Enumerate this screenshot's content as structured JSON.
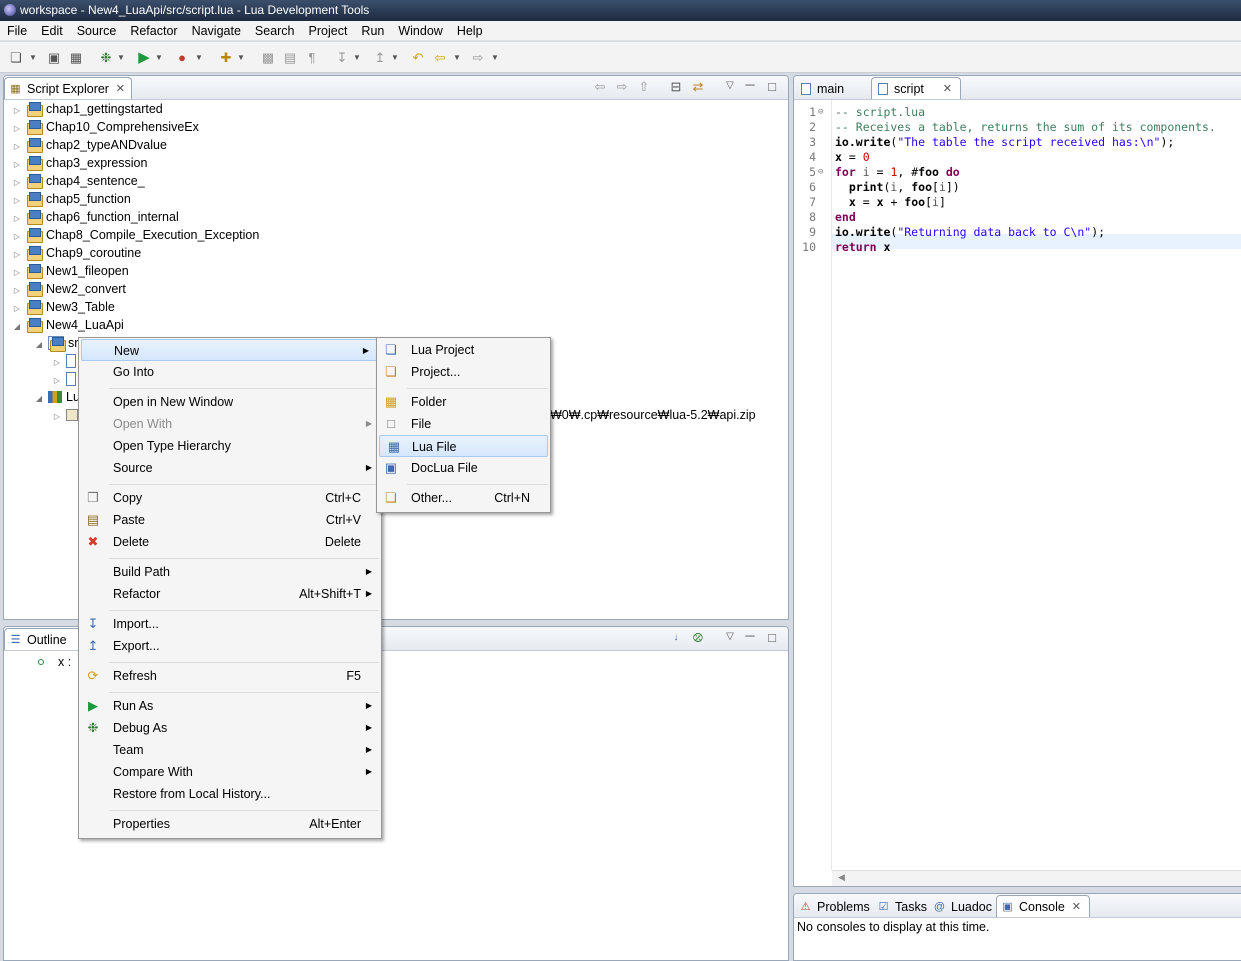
{
  "window": {
    "title": "workspace - New4_LuaApi/src/script.lua - Lua Development Tools"
  },
  "menubar": [
    "File",
    "Edit",
    "Source",
    "Refactor",
    "Navigate",
    "Search",
    "Project",
    "Run",
    "Window",
    "Help"
  ],
  "explorer": {
    "tab_label": "Script Explorer",
    "projects": [
      "chap1_gettingstarted",
      "Chap10_ComprehensiveEx",
      "chap2_typeANDvalue",
      "chap3_expression",
      "chap4_sentence_",
      "chap5_function",
      "chap6_function_internal",
      "Chap8_Compile_Execution_Exception",
      "Chap9_coroutine",
      "New1_fileopen",
      "New2_convert",
      "New3_Table",
      "New4_LuaApi"
    ],
    "src_label": "src",
    "lib_label": "Lu",
    "lib_path_fragment": "₩0₩.cp₩resource₩lua-5.2₩api.zip"
  },
  "outline": {
    "tab_label": "Outline",
    "item": "x :"
  },
  "context_menu": {
    "items": [
      {
        "label": "New",
        "shortcut": "",
        "submenu": true
      },
      {
        "label": "Go Into",
        "shortcut": "",
        "submenu": false
      },
      {
        "label": "Open in New Window",
        "shortcut": "",
        "submenu": false
      },
      {
        "label": "Open With",
        "shortcut": "",
        "submenu": true,
        "disabled": true
      },
      {
        "label": "Open Type Hierarchy",
        "shortcut": "",
        "submenu": false
      },
      {
        "label": "Source",
        "shortcut": "",
        "submenu": true
      },
      {
        "label": "Copy",
        "shortcut": "Ctrl+C",
        "submenu": false,
        "icon": "copy-icon"
      },
      {
        "label": "Paste",
        "shortcut": "Ctrl+V",
        "submenu": false,
        "icon": "paste-icon"
      },
      {
        "label": "Delete",
        "shortcut": "Delete",
        "submenu": false,
        "icon": "delete-icon"
      },
      {
        "label": "Build Path",
        "shortcut": "",
        "submenu": true
      },
      {
        "label": "Refactor",
        "shortcut": "Alt+Shift+T",
        "submenu": true
      },
      {
        "label": "Import...",
        "shortcut": "",
        "submenu": false,
        "icon": "import-icon"
      },
      {
        "label": "Export...",
        "shortcut": "",
        "submenu": false,
        "icon": "export-icon"
      },
      {
        "label": "Refresh",
        "shortcut": "F5",
        "submenu": false,
        "icon": "refresh-icon"
      },
      {
        "label": "Run As",
        "shortcut": "",
        "submenu": true,
        "icon": "run-icon"
      },
      {
        "label": "Debug As",
        "shortcut": "",
        "submenu": true,
        "icon": "debug-icon"
      },
      {
        "label": "Team",
        "shortcut": "",
        "submenu": true
      },
      {
        "label": "Compare With",
        "shortcut": "",
        "submenu": true
      },
      {
        "label": "Restore from Local History...",
        "shortcut": "",
        "submenu": false
      },
      {
        "label": "Properties",
        "shortcut": "Alt+Enter",
        "submenu": false
      }
    ]
  },
  "new_submenu": {
    "items": [
      {
        "label": "Lua Project",
        "shortcut": ""
      },
      {
        "label": "Project...",
        "shortcut": ""
      },
      {
        "label": "Folder",
        "shortcut": ""
      },
      {
        "label": "File",
        "shortcut": ""
      },
      {
        "label": "Lua File",
        "shortcut": ""
      },
      {
        "label": "DocLua File",
        "shortcut": ""
      },
      {
        "label": "Other...",
        "shortcut": "Ctrl+N"
      }
    ]
  },
  "editor": {
    "tabs": [
      "main",
      "script"
    ],
    "lines": [
      "-- script.lua",
      "-- Receives a table, returns the sum of its components.",
      "io.write(\"The table the script received has:\\n\");",
      "x = 0",
      "for i = 1, #foo do",
      "  print(i, foo[i])",
      "  x = x + foo[i]",
      "end",
      "io.write(\"Returning data back to C\\n\");",
      "return x"
    ]
  },
  "bottom": {
    "tabs": [
      "Problems",
      "Tasks",
      "Luadoc",
      "Console"
    ],
    "console_message": "No consoles to display at this time."
  }
}
